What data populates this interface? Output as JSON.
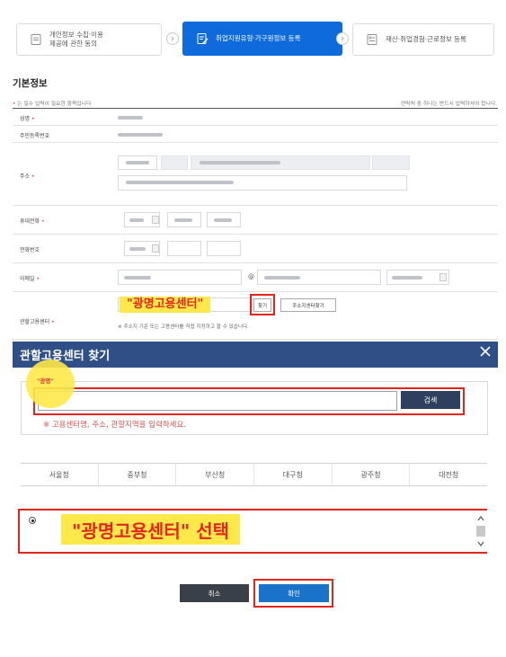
{
  "stepper": {
    "steps": [
      {
        "label_line1": "개인정보 수집·이용",
        "label_line2": "제공에 관한 동의",
        "state": "done"
      },
      {
        "label": "취업지원유형·가구원정보 등록",
        "state": "active"
      },
      {
        "label": "재산·취업경험·근로정보 등록",
        "state": "pending"
      }
    ]
  },
  "form": {
    "section_title": "기본정보",
    "required_note": "는 필수 입력이 필요한 항목입니다",
    "required_mark": "•",
    "contact_note": "연락처 중 하나는 반드시 입력하셔야 합니다.",
    "rows": {
      "name": {
        "label": "성명",
        "req": "•"
      },
      "rrn": {
        "label": "주민등록번호"
      },
      "address": {
        "label": "주소",
        "req": "•"
      },
      "mobile": {
        "label": "휴대전화",
        "req": "•"
      },
      "phone": {
        "label": "전화번호"
      },
      "email": {
        "label": "이메일",
        "req": "•",
        "at": "@"
      },
      "center": {
        "label": "관할고용센터",
        "req": "•"
      }
    },
    "center_callout": "\"광명고용센터\"",
    "find_button": "찾기",
    "address_center_button": "주소지센터찾기",
    "center_note": "※ 주소지 기준 또는 고용센터를 직접 지정하고 할 수 있습니다."
  },
  "modal": {
    "title": "관할고용센터 찾기",
    "search_callout": "\"광명\"",
    "search_button": "검색",
    "search_hint": "※ 고용센터명, 주소, 관할지역을 입력하세요.",
    "region_tabs": [
      "서울청",
      "중부청",
      "부산청",
      "대구청",
      "광주청",
      "대전청"
    ],
    "result_callout": "\"광명고용센터\" 선택",
    "cancel_button": "취소",
    "ok_button": "확인"
  },
  "colors": {
    "active_step": "#0f6bdb",
    "modal_header": "#2f4f86",
    "highlight": "#ffe94a",
    "annotation_red": "#e2261e"
  }
}
